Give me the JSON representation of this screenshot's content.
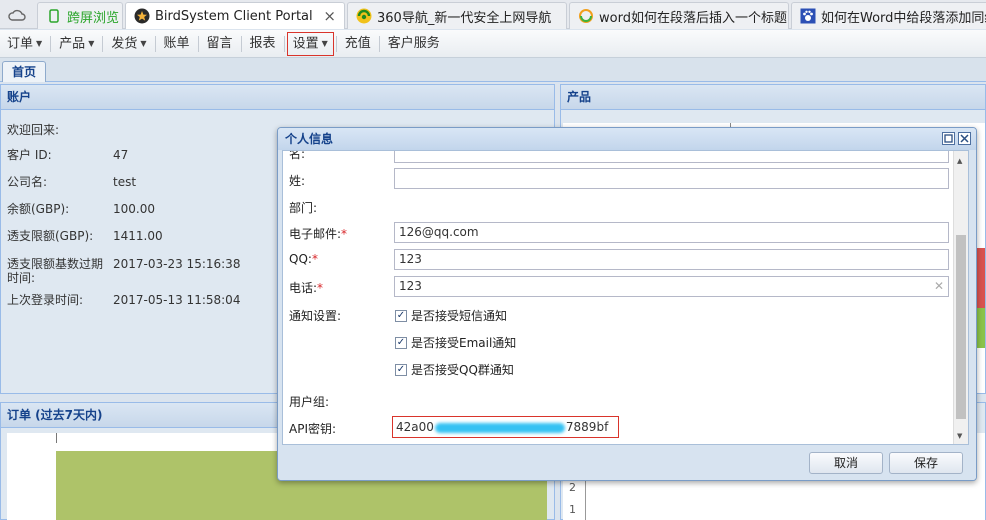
{
  "browser": {
    "home_icon": "cloud-icon",
    "tabs": [
      {
        "label": "跨屏浏览",
        "icon": "phone-icon"
      },
      {
        "label": "BirdSystem Client Portal",
        "icon": "bird-icon",
        "close": "×"
      },
      {
        "label": "360导航_新一代安全上网导航",
        "icon": "360-logo-icon"
      },
      {
        "label": "word如何在段落后插入一个标题",
        "icon": "search-ring-icon"
      },
      {
        "label": "如何在Word中给段落添加同级",
        "icon": "paw-icon"
      }
    ]
  },
  "menu": {
    "items": [
      {
        "label": "订单",
        "dropdown": true
      },
      {
        "label": "产品",
        "dropdown": true
      },
      {
        "label": "发货",
        "dropdown": true
      },
      {
        "label": "账单",
        "dropdown": false
      },
      {
        "label": "留言",
        "dropdown": false
      },
      {
        "label": "报表",
        "dropdown": false
      },
      {
        "label": "设置",
        "dropdown": true,
        "highlighted": true
      },
      {
        "label": "充值",
        "dropdown": false
      },
      {
        "label": "客户服务",
        "dropdown": false
      }
    ]
  },
  "home_tab": "首页",
  "account_panel": {
    "title": "账户",
    "welcome": "欢迎回来:",
    "rows": [
      {
        "label": "客户 ID:",
        "value": "47"
      },
      {
        "label": "公司名:",
        "value": "test"
      },
      {
        "label": "余额(GBP):",
        "value": "100.00"
      },
      {
        "label": "透支限额(GBP):",
        "value": "1411.00"
      },
      {
        "label": "透支限额基数过期时间:",
        "value": "2017-03-23 15:16:38"
      },
      {
        "label": "上次登录时间:",
        "value": "2017-05-13 11:58:04"
      }
    ]
  },
  "product_panel": {
    "title": "产品"
  },
  "order_panel": {
    "title": "订单 (过去7天内)"
  },
  "right_chart": {
    "tick_labels": [
      "2",
      "1"
    ]
  },
  "modal": {
    "title": "个人信息",
    "first_name_label": "名:",
    "last_name_label": "姓:",
    "department_label": "部门:",
    "email_label": "电子邮件:",
    "email_value": "126@qq.com",
    "qq_label": "QQ:",
    "qq_value": "123",
    "phone_label": "电话:",
    "phone_value": "123",
    "required_mark": "*",
    "notify_label": "通知设置:",
    "notify_options": [
      {
        "label": "是否接受短信通知",
        "checked": true
      },
      {
        "label": "是否接受Email通知",
        "checked": true
      },
      {
        "label": "是否接受QQ群通知",
        "checked": true
      }
    ],
    "user_group_label": "用户组:",
    "api_key_label": "API密钥:",
    "api_key_prefix": "42a00",
    "api_key_suffix": "7889bf",
    "cancel_label": "取消",
    "save_label": "保存"
  },
  "colors": {
    "accent": "#15428b",
    "panel_border": "#99bbe8",
    "required": "#d8262a",
    "highlight_border": "#d9342b",
    "chart_green": "#aec369",
    "blur_blue": "#35c2f3"
  }
}
